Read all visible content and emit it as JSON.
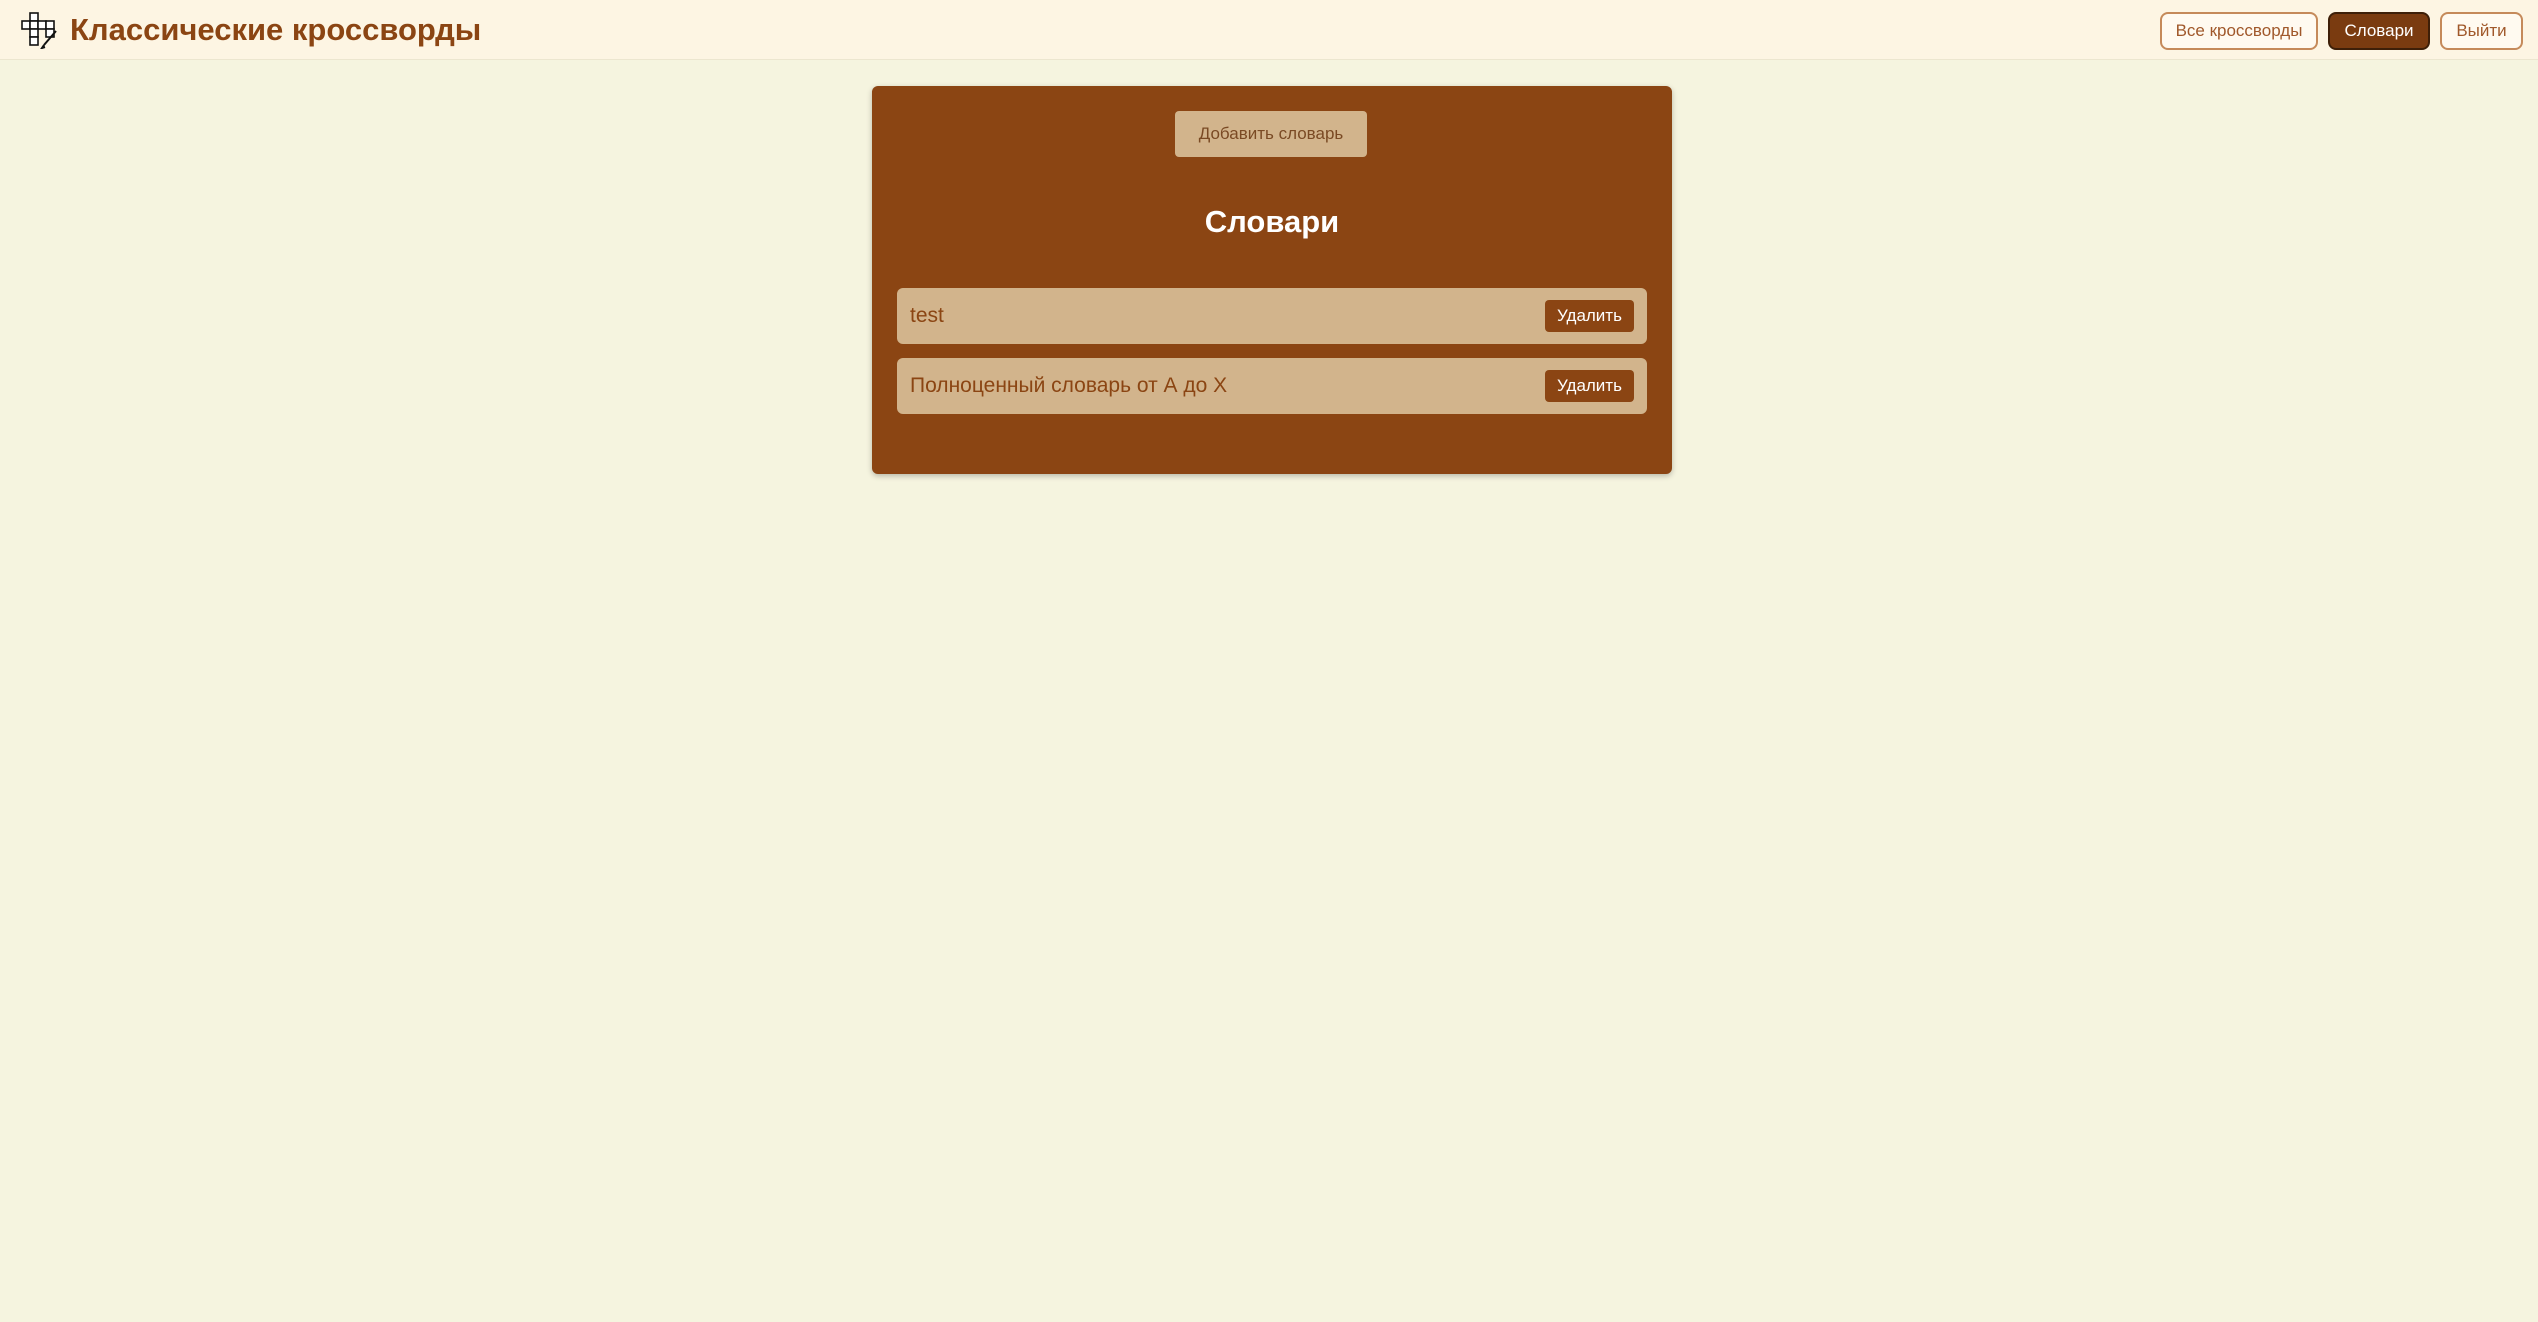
{
  "header": {
    "logo_icon": "crossword-pencil-icon",
    "title": "Классические кроссворды",
    "nav": {
      "all_crosswords": "Все кроссворды",
      "dictionaries": "Словари",
      "logout": "Выйти"
    },
    "active_nav": "dictionaries"
  },
  "main": {
    "add_button": "Добавить словарь",
    "title": "Словари",
    "dictionaries": [
      {
        "name": "test",
        "delete_label": "Удалить"
      },
      {
        "name": "Полноценный словарь от А до Х",
        "delete_label": "Удалить"
      }
    ]
  },
  "colors": {
    "background": "#f5f4df",
    "header_background": "#fdf5e3",
    "brand": "#8b4513",
    "row_background": "#d2b48c",
    "active_nav": "#7a3b10"
  }
}
